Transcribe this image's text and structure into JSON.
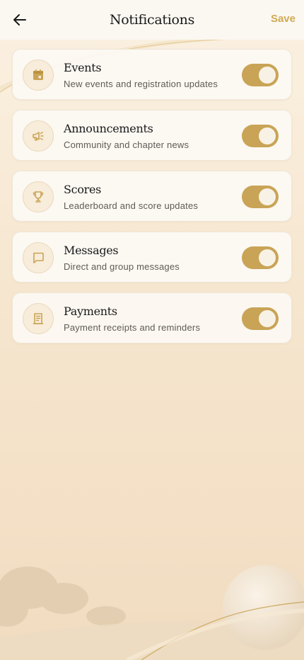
{
  "header": {
    "title": "Notifications",
    "save_label": "Save",
    "back_icon": "arrow-left-icon"
  },
  "notifications": [
    {
      "title": "Events",
      "subtitle": "New events and registration updates",
      "icon": "calendar-icon",
      "enabled": true
    },
    {
      "title": "Announcements",
      "subtitle": "Community and chapter news",
      "icon": "megaphone-icon",
      "enabled": true
    },
    {
      "title": "Scores",
      "subtitle": "Leaderboard and score updates",
      "icon": "trophy-icon",
      "enabled": true
    },
    {
      "title": "Messages",
      "subtitle": "Direct and group messages",
      "icon": "message-icon",
      "enabled": true
    },
    {
      "title": "Payments",
      "subtitle": "Payment receipts and reminders",
      "icon": "receipt-icon",
      "enabled": true
    }
  ],
  "colors": {
    "accent": "#c9a456",
    "save": "#d0aa55",
    "background": "#f5e9d6"
  }
}
